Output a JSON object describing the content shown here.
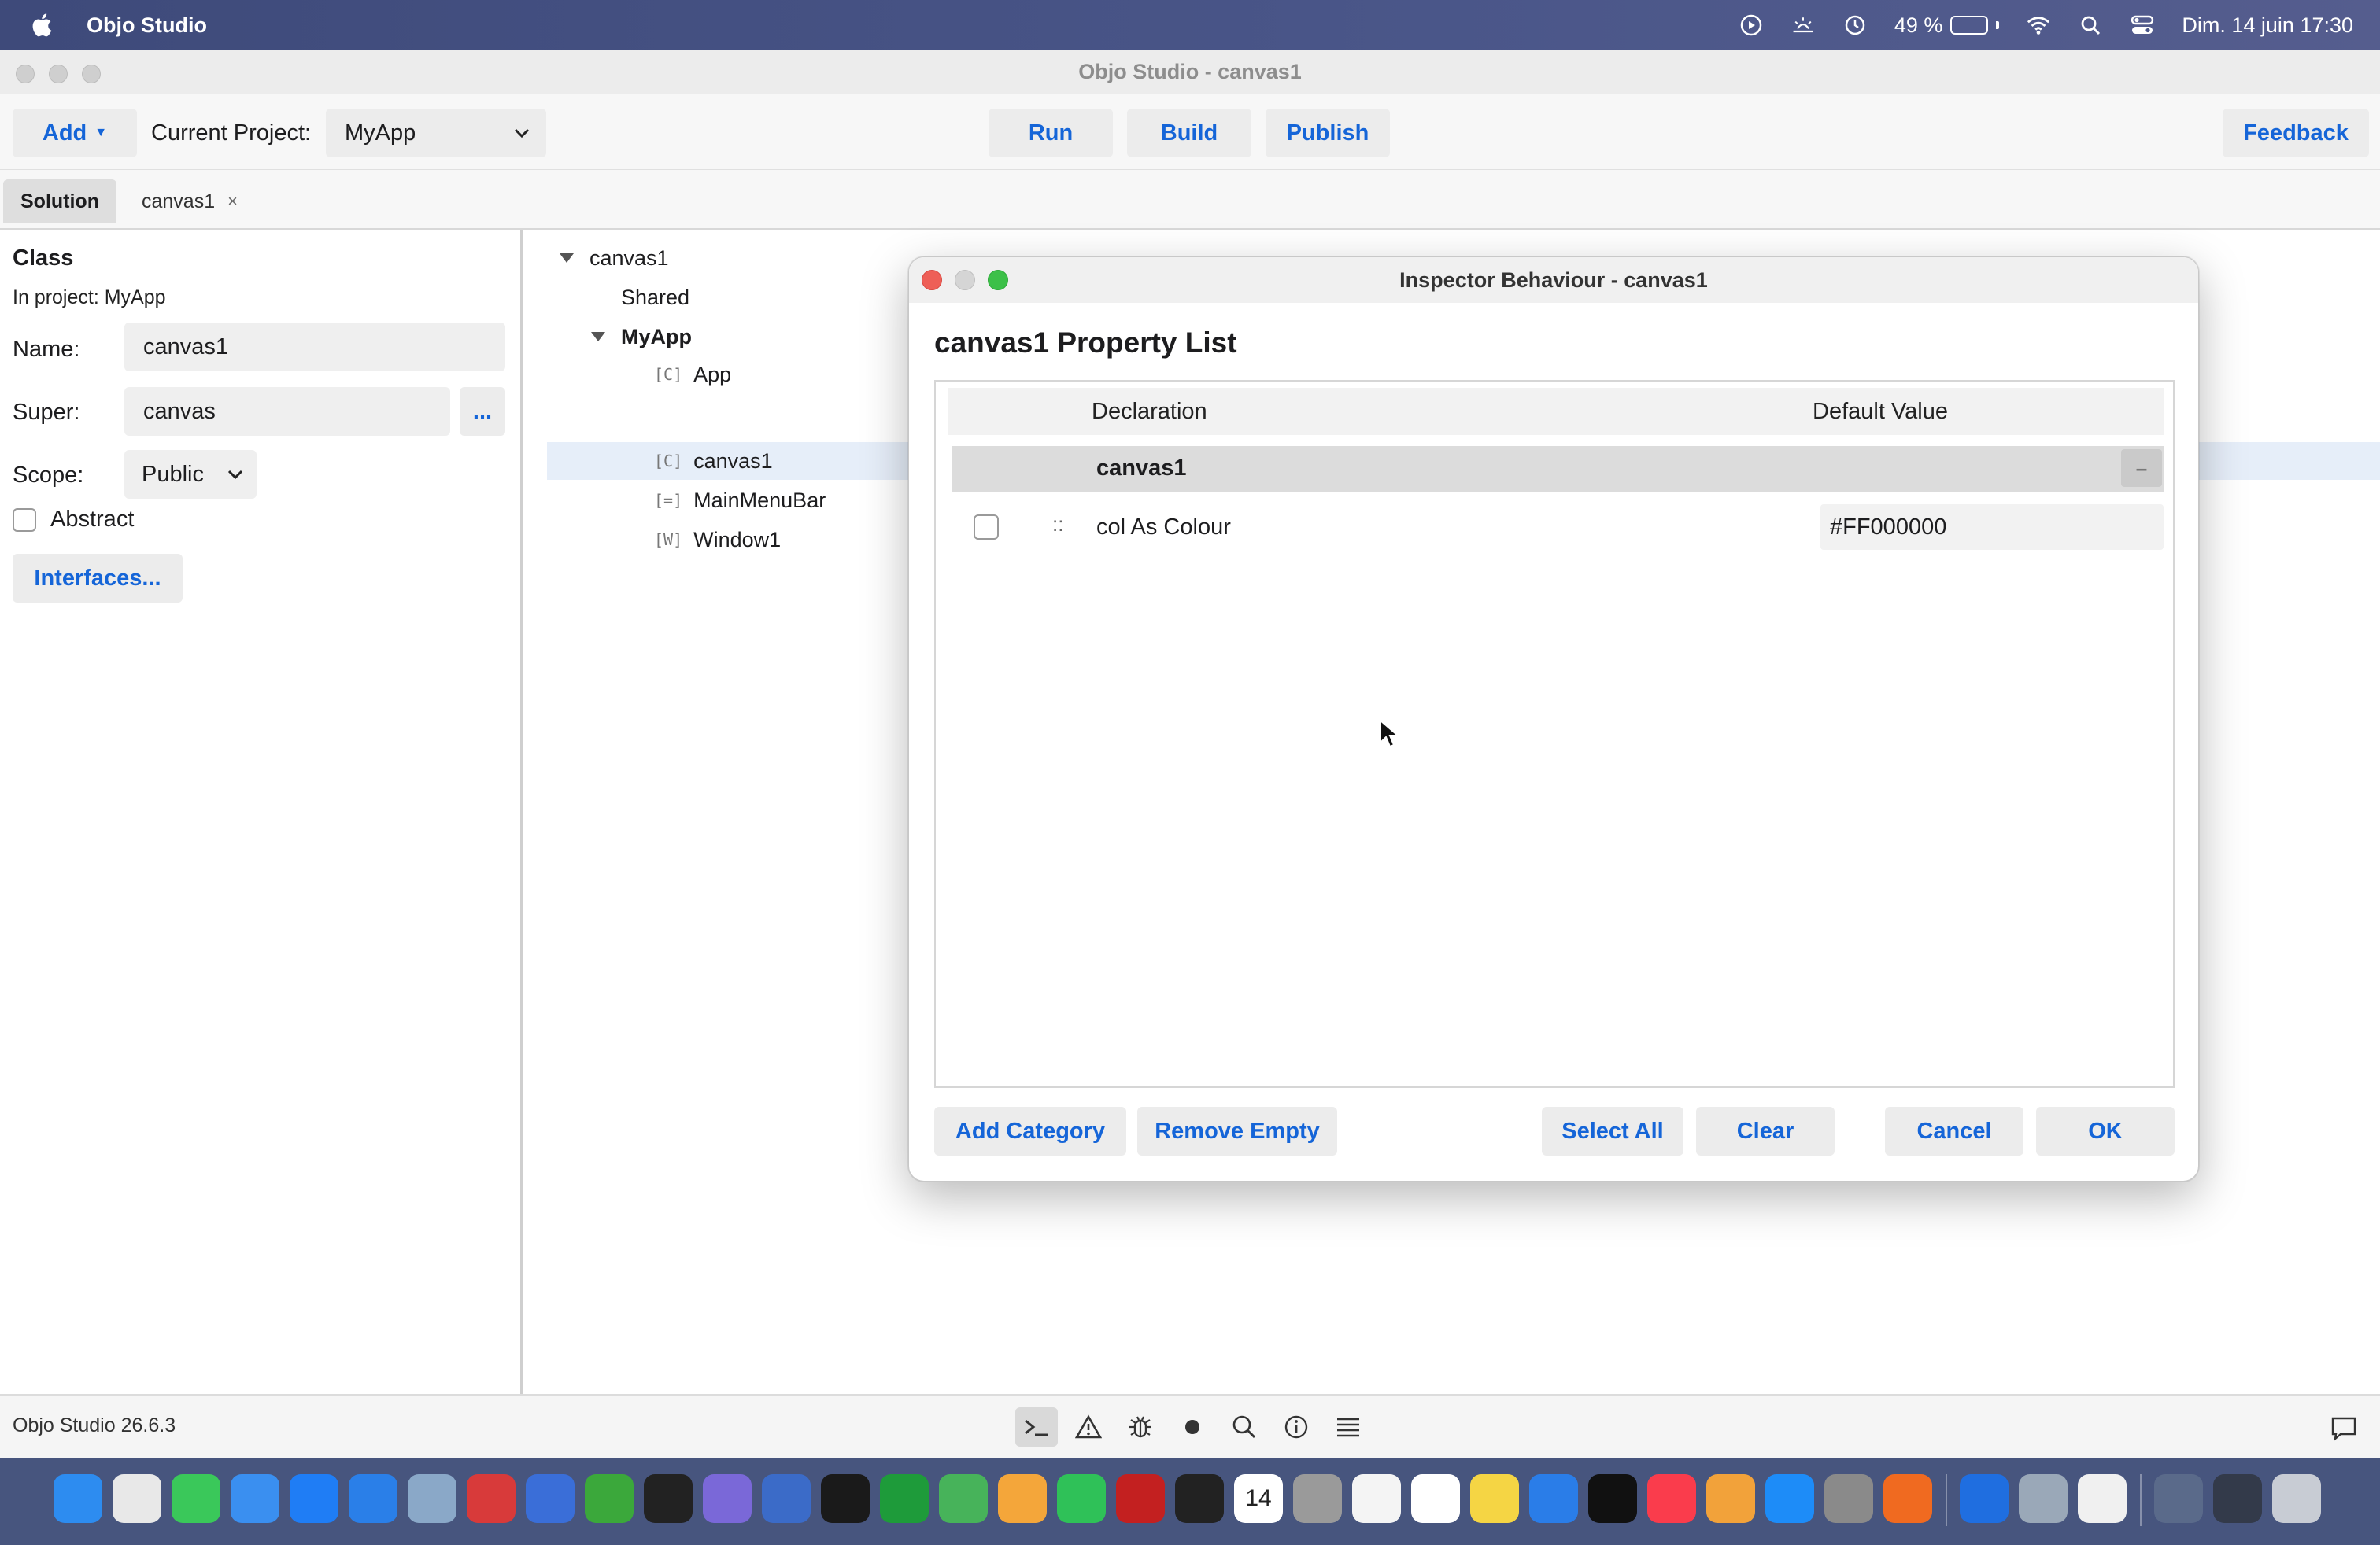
{
  "menubar": {
    "app_name": "Objo Studio",
    "battery_percent": "49 %",
    "battery_level": 0.49,
    "datetime": "Dim. 14 juin  17:30",
    "icons": [
      "apple-icon",
      "play-circle-icon",
      "sunrise-icon",
      "time-machine-icon",
      "battery-icon",
      "wifi-icon",
      "spotlight-icon",
      "control-center-icon"
    ]
  },
  "window": {
    "title": "Objo Studio - canvas1"
  },
  "toolbar": {
    "add_label": "Add",
    "current_project_label": "Current Project:",
    "project_value": "MyApp",
    "run_label": "Run",
    "build_label": "Build",
    "publish_label": "Publish",
    "feedback_label": "Feedback"
  },
  "tabs": {
    "solution_label": "Solution",
    "editor_tab_label": "canvas1",
    "close_glyph": "×"
  },
  "class_panel": {
    "heading": "Class",
    "in_project": "In project: MyApp",
    "name_label": "Name:",
    "name_value": "canvas1",
    "super_label": "Super:",
    "super_value": "canvas",
    "super_button": "...",
    "scope_label": "Scope:",
    "scope_value": "Public",
    "abstract_label": "Abstract",
    "abstract_checked": false,
    "interfaces_label": "Interfaces..."
  },
  "tree": {
    "root": "canvas1",
    "shared": "Shared",
    "group": "MyApp",
    "items": [
      {
        "kind": "[C]",
        "label": "App"
      },
      {
        "kind": "[C]",
        "label": "canvas1"
      },
      {
        "kind": "[=]",
        "label": "MainMenuBar"
      },
      {
        "kind": "[W]",
        "label": "Window1"
      }
    ],
    "selected": "canvas1"
  },
  "status": {
    "version": "Objo Studio 26.6.3",
    "icons": [
      "terminal-icon",
      "warning-icon",
      "bug-icon",
      "record-icon",
      "search-icon",
      "info-icon",
      "list-icon",
      "chat-icon"
    ]
  },
  "dialog": {
    "title": "Inspector Behaviour - canvas1",
    "heading": "canvas1 Property List",
    "col_declaration": "Declaration",
    "col_default": "Default Value",
    "category": "canvas1",
    "collapse_glyph": "–",
    "property": {
      "drag_glyph": "::",
      "declaration": "col As Colour",
      "default_value": "#FF000000",
      "checked": false
    },
    "buttons": {
      "add_category": "Add Category",
      "remove_empty": "Remove Empty",
      "select_all": "Select All",
      "clear": "Clear",
      "cancel": "Cancel",
      "ok": "OK"
    }
  },
  "dock": {
    "apps": [
      "finder",
      "launchpad",
      "messages",
      "mail",
      "safari",
      "xcode",
      "preview",
      "textwrangler",
      "package",
      "xbox",
      "terminal",
      "objo",
      "network-radar",
      "chatgpt",
      "numbers",
      "maps",
      "photos",
      "facetime",
      "filezilla",
      "activity-monitor",
      "calendar",
      "contacts",
      "reminders",
      "textedit",
      "notes",
      "freeform",
      "tv",
      "music",
      "pages",
      "app-store",
      "system-settings",
      "firefox",
      "xcode-beta",
      "disk-utility",
      "document",
      "downloads",
      "stack",
      "trash"
    ],
    "calendar_day": "14"
  },
  "colors": {
    "accent": "#1565d8",
    "selection": "#e6eef9",
    "close_red": "#ee5f57",
    "minimize_yellow": "#d5d5d5",
    "zoom_green": "#3cc048"
  }
}
